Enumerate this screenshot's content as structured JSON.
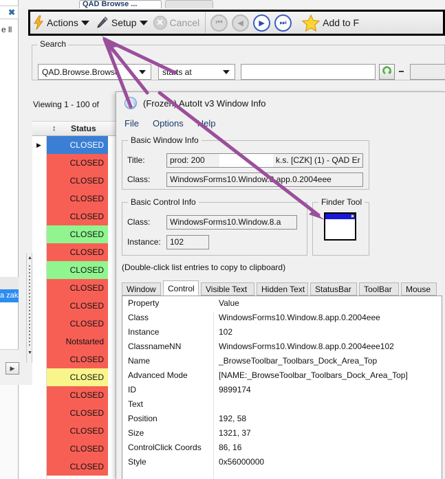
{
  "app": {
    "tab_label": "QAD Browse ...",
    "toolbar": {
      "actions_label": "Actions",
      "setup_label": "Setup",
      "cancel_label": "Cancel",
      "add_to_fav_label": "Add to F",
      "icons": {
        "lightning": "lightning-icon",
        "pencil": "pencil-icon",
        "cancel": "cancel-icon",
        "first": "first-record-icon",
        "prev": "previous-record-icon",
        "next": "next-record-icon",
        "last": "last-record-icon",
        "star": "favorite-star-icon"
      }
    },
    "search": {
      "legend": "Search",
      "field_select_value": "QAD.Browse.Browse",
      "operator_select_value": "starts at",
      "value_input": "",
      "value_input_placeholder": "",
      "range_input": "",
      "refresh_icon": "refresh-icon",
      "separator": "-"
    },
    "viewing_text": "Viewing 1 - 100 of",
    "grid": {
      "sort_icon": "sort-updown-icon",
      "column_status": "Status",
      "rows": [
        {
          "status": "CLOSED",
          "bg": "#3b7fd4",
          "fg": "#ffffff",
          "selected": true,
          "marker": "▶"
        },
        {
          "status": "CLOSED",
          "bg": "#f75f55",
          "fg": "#111111",
          "selected": false,
          "marker": ""
        },
        {
          "status": "CLOSED",
          "bg": "#f75f55",
          "fg": "#111111",
          "selected": false,
          "marker": ""
        },
        {
          "status": "CLOSED",
          "bg": "#f75f55",
          "fg": "#111111",
          "selected": false,
          "marker": ""
        },
        {
          "status": "CLOSED",
          "bg": "#f75f55",
          "fg": "#111111",
          "selected": false,
          "marker": ""
        },
        {
          "status": "CLOSED",
          "bg": "#90f58f",
          "fg": "#111111",
          "selected": false,
          "marker": ""
        },
        {
          "status": "CLOSED",
          "bg": "#f75f55",
          "fg": "#111111",
          "selected": false,
          "marker": ""
        },
        {
          "status": "CLOSED",
          "bg": "#90f58f",
          "fg": "#111111",
          "selected": false,
          "marker": ""
        },
        {
          "status": "CLOSED",
          "bg": "#f75f55",
          "fg": "#111111",
          "selected": false,
          "marker": ""
        },
        {
          "status": "CLOSED",
          "bg": "#f75f55",
          "fg": "#111111",
          "selected": false,
          "marker": ""
        },
        {
          "status": "CLOSED",
          "bg": "#f75f55",
          "fg": "#111111",
          "selected": false,
          "marker": ""
        },
        {
          "status": "Notstarted",
          "bg": "#f75f55",
          "fg": "#111111",
          "selected": false,
          "marker": ""
        },
        {
          "status": "CLOSED",
          "bg": "#f75f55",
          "fg": "#111111",
          "selected": false,
          "marker": ""
        },
        {
          "status": "CLOSED",
          "bg": "#f8f58b",
          "fg": "#111111",
          "selected": false,
          "marker": ""
        },
        {
          "status": "CLOSED",
          "bg": "#f75f55",
          "fg": "#111111",
          "selected": false,
          "marker": ""
        },
        {
          "status": "CLOSED",
          "bg": "#f75f55",
          "fg": "#111111",
          "selected": false,
          "marker": ""
        },
        {
          "status": "CLOSED",
          "bg": "#f75f55",
          "fg": "#111111",
          "selected": false,
          "marker": ""
        },
        {
          "status": "CLOSED",
          "bg": "#f75f55",
          "fg": "#111111",
          "selected": false,
          "marker": ""
        },
        {
          "status": "CLOSED",
          "bg": "#f75f55",
          "fg": "#111111",
          "selected": false,
          "marker": ""
        }
      ]
    },
    "left_pane": {
      "close_label": "✖",
      "partial_label_ii": "e ll",
      "selected_item_label": "a zaká",
      "expand_arrow": "▶"
    }
  },
  "autoit": {
    "window_title": "(Frozen) AutoIt v3 Window Info",
    "logo_icon": "autoit-logo-icon",
    "menus": [
      "File",
      "Options",
      "Help"
    ],
    "basic_window_info": {
      "legend": "Basic Window Info",
      "title_label": "Title:",
      "title_value_left": "prod: 200",
      "title_value_right": "k.s. [CZK] (1) - QAD Er",
      "class_label": "Class:",
      "class_value": "WindowsForms10.Window.8.app.0.2004eee"
    },
    "basic_control_info": {
      "legend": "Basic Control Info",
      "class_label": "Class:",
      "class_value": "WindowsForms10.Window.8.a",
      "instance_label": "Instance:",
      "instance_value": "102"
    },
    "finder_tool": {
      "legend": "Finder Tool",
      "icon": "finder-tool-window-icon"
    },
    "hint": "(Double-click list entries to copy to clipboard)",
    "tabs": [
      {
        "label": "Window",
        "active": false
      },
      {
        "label": "Control",
        "active": true
      },
      {
        "label": "Visible Text",
        "active": false
      },
      {
        "label": "Hidden Text",
        "active": false
      },
      {
        "label": "StatusBar",
        "active": false
      },
      {
        "label": "ToolBar",
        "active": false
      },
      {
        "label": "Mouse",
        "active": false
      }
    ],
    "listview": {
      "col_property": "Property",
      "col_value": "Value",
      "rows": [
        {
          "property": "Class",
          "value": "WindowsForms10.Window.8.app.0.2004eee"
        },
        {
          "property": "Instance",
          "value": "102"
        },
        {
          "property": "ClassnameNN",
          "value": "WindowsForms10.Window.8.app.0.2004eee102"
        },
        {
          "property": "Name",
          "value": "_BrowseToolbar_Toolbars_Dock_Area_Top"
        },
        {
          "property": "Advanced Mode",
          "value": "[NAME:_BrowseToolbar_Toolbars_Dock_Area_Top]"
        },
        {
          "property": "ID",
          "value": "9899174"
        },
        {
          "property": "Text",
          "value": ""
        },
        {
          "property": "Position",
          "value": "192, 58"
        },
        {
          "property": "Size",
          "value": "1321, 37"
        },
        {
          "property": "ControlClick Coords",
          "value": "86, 16"
        },
        {
          "property": "Style",
          "value": "0x56000000"
        }
      ]
    }
  },
  "annotation": {
    "color": "#9b4f9b",
    "description": "purple-arrows-pointing-to-toolbar"
  }
}
